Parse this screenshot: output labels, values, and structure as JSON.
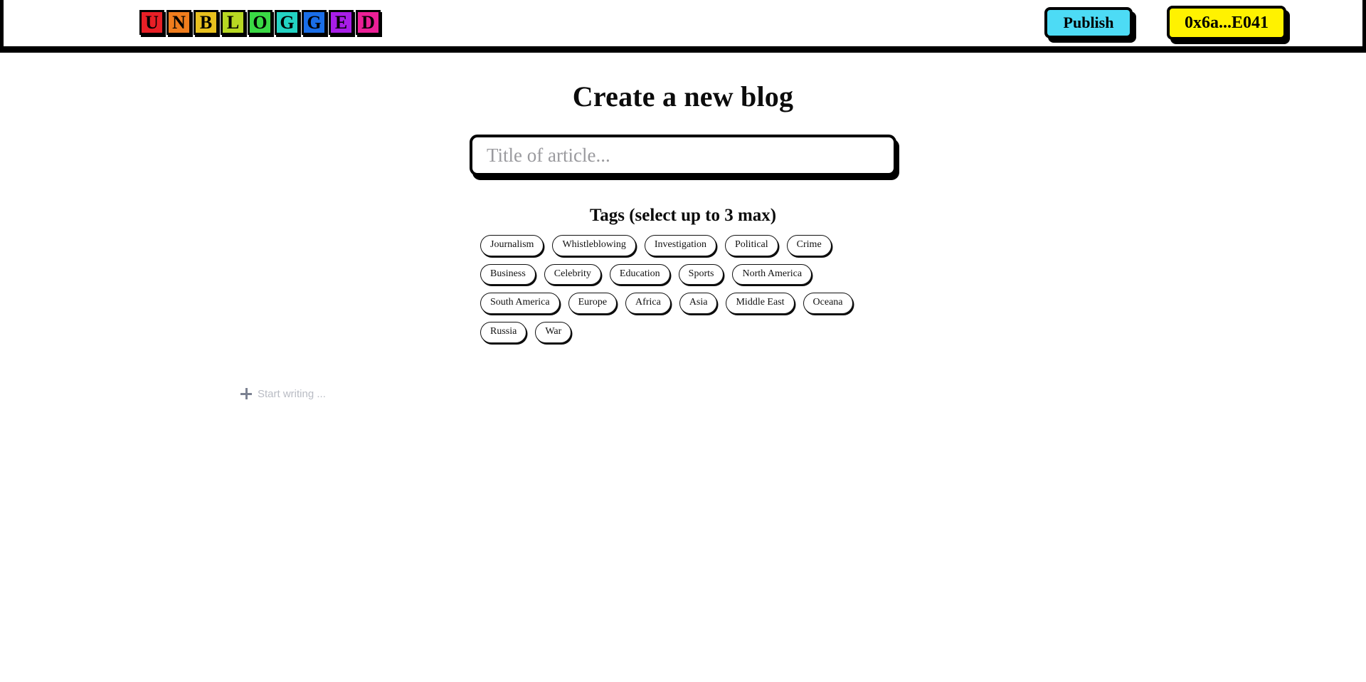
{
  "header": {
    "logo_tiles": [
      {
        "letter": "U",
        "color": "#e81f26"
      },
      {
        "letter": "N",
        "color": "#f07d1d"
      },
      {
        "letter": "B",
        "color": "#e8c01e"
      },
      {
        "letter": "L",
        "color": "#b8d922"
      },
      {
        "letter": "O",
        "color": "#3ad945"
      },
      {
        "letter": "G",
        "color": "#23d3c3"
      },
      {
        "letter": "G",
        "color": "#1a6ee8"
      },
      {
        "letter": "E",
        "color": "#a81de8"
      },
      {
        "letter": "D",
        "color": "#ec1f97"
      }
    ],
    "publish_label": "Publish",
    "publish_color": "#4ddbf5",
    "wallet_label": "0x6a...E041",
    "wallet_color": "#fff200"
  },
  "main": {
    "page_title": "Create a new blog",
    "title_input": {
      "value": "",
      "placeholder": "Title of article..."
    },
    "tags_heading": "Tags (select up to 3 max)",
    "tags": [
      "Journalism",
      "Whistleblowing",
      "Investigation",
      "Political",
      "Crime",
      "Business",
      "Celebrity",
      "Education",
      "Sports",
      "North America",
      "South America",
      "Europe",
      "Africa",
      "Asia",
      "Middle East",
      "Oceana",
      "Russia",
      "War"
    ],
    "editor_placeholder": "Start writing ...",
    "editor_icon": "plus-icon"
  }
}
